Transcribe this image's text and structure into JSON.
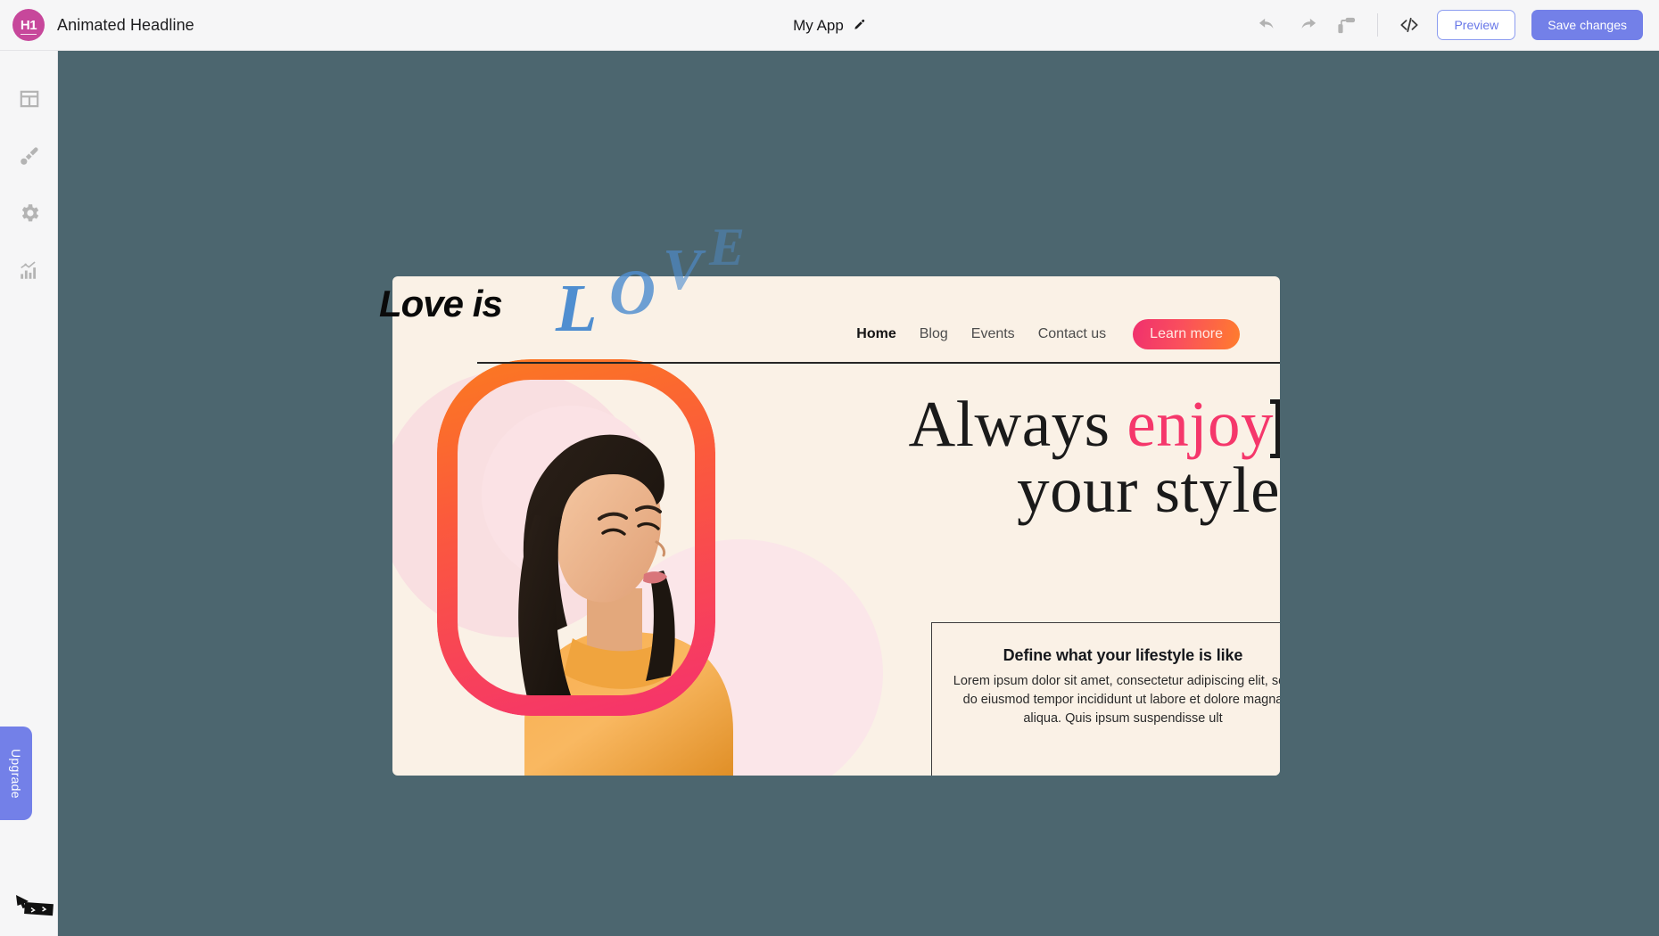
{
  "topbar": {
    "logo_text": "H1",
    "logo_color": "#c7479b",
    "app_name": "Animated Headline",
    "center_title": "My App",
    "edit_icon": "pencil-icon",
    "tools": [
      {
        "name": "undo-icon",
        "label": "Undo"
      },
      {
        "name": "redo-icon",
        "label": "Redo"
      },
      {
        "name": "paint-roller-icon",
        "label": "Theme"
      },
      {
        "name": "code-icon",
        "label": "Code"
      }
    ],
    "preview_label": "Preview",
    "save_label": "Save changes",
    "preview_color": "#6877e8",
    "save_color": "#7380e8"
  },
  "sidebar": {
    "items": [
      {
        "name": "sidebar-item-layout",
        "icon": "layout-grid-icon",
        "label": "Layout"
      },
      {
        "name": "sidebar-item-design",
        "icon": "paintbrush-icon",
        "label": "Design"
      },
      {
        "name": "sidebar-item-settings",
        "icon": "gear-icon",
        "label": "Settings"
      },
      {
        "name": "sidebar-item-analytics",
        "icon": "chart-bar-icon",
        "label": "Analytics"
      }
    ],
    "upgrade_label": "Upgrade",
    "upgrade_color": "#7380e8"
  },
  "stage": {
    "background_color": "#4c666f"
  },
  "canvas": {
    "background_color": "#faf1e6",
    "animated_headline": {
      "static_text": "Love is",
      "animated_letters": [
        {
          "char": "L",
          "opacity": 1.0
        },
        {
          "char": "O",
          "opacity": 0.8
        },
        {
          "char": "V",
          "opacity": 0.6
        },
        {
          "char": "E",
          "opacity": 0.45
        }
      ],
      "color": "#4f8ed0"
    },
    "nav": {
      "items": [
        {
          "label": "Home",
          "active": true
        },
        {
          "label": "Blog",
          "active": false
        },
        {
          "label": "Events",
          "active": false
        },
        {
          "label": "Contact us",
          "active": false
        }
      ],
      "cta_label": "Learn more",
      "cta_gradient_from": "#f0306e",
      "cta_gradient_to": "#ff7d2d"
    },
    "hero": {
      "line1_a": "Always ",
      "line1_b": "enjoy",
      "line2": "your style",
      "accent_color": "#f5376b",
      "caret": "text-caret"
    },
    "info_card": {
      "heading": "Define what your lifestyle is like",
      "body": "Lorem ipsum dolor sit amet, consectetur adipiscing elit, sed do eiusmod tempor incididunt ut labore et dolore magna aliqua. Quis ipsum suspendisse ult"
    },
    "photo": {
      "alt": "woman-in-orange-sweater",
      "ring_gradient_from": "#fb7a20",
      "ring_gradient_to": "#f5316e",
      "blob_color": "#f9dfe1"
    }
  }
}
